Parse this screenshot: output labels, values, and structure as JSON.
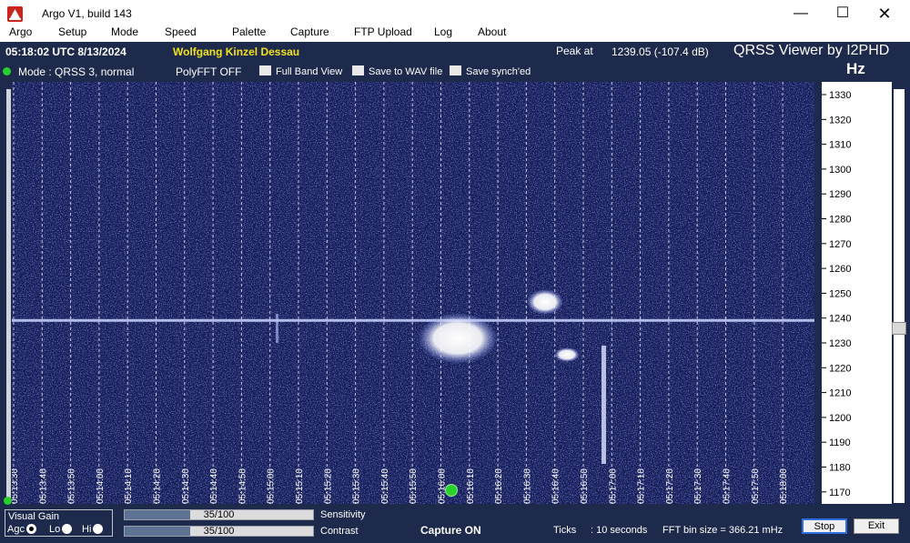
{
  "window": {
    "title": "Argo V1, build 143",
    "minimize": "—",
    "maximize": "☐",
    "close": "✕"
  },
  "menu": [
    "Argo",
    "Setup",
    "Mode",
    "Speed",
    "Palette",
    "Capture",
    "FTP Upload",
    "Log",
    "About"
  ],
  "status": {
    "time": "05:18:02 UTC  8/13/2024",
    "name": "Wolfgang Kinzel Dessau",
    "peak_label": "Peak at",
    "peak_value": "1239.05 (-107.4 dB)",
    "brand": "QRSS Viewer by I2PHD",
    "unit": "Hz"
  },
  "options": {
    "mode": "Mode : QRSS 3, normal",
    "polyfft": "PolyFFT OFF",
    "checkboxes": [
      "Full Band View",
      "Save to WAV file",
      "Save synch'ed"
    ]
  },
  "freq_axis": {
    "ticks": [
      "1330",
      "1320",
      "1310",
      "1300",
      "1290",
      "1280",
      "1270",
      "1260",
      "1250",
      "1240",
      "1230",
      "1220",
      "1210",
      "1200",
      "1190",
      "1180",
      "1170"
    ],
    "signal_hz": 1239.05
  },
  "time_axis": {
    "labels": [
      "05:13:30",
      "05:13:40",
      "05:13:50",
      "05:14:00",
      "05:14:10",
      "05:14:20",
      "05:14:30",
      "05:14:40",
      "05:14:50",
      "05:15:00",
      "05:15:10",
      "05:15:20",
      "05:15:30",
      "05:15:40",
      "05:15:50",
      "05:16:00",
      "05:16:10",
      "05:16:20",
      "05:16:30",
      "05:16:40",
      "05:16:50",
      "05:17:00",
      "05:17:10",
      "05:17:20",
      "05:17:30",
      "05:17:40",
      "05:17:50",
      "05:18:00"
    ]
  },
  "controls": {
    "visual_gain": {
      "title": "Visual Gain",
      "agc": "Agc",
      "lo": "Lo",
      "hi": "Hi",
      "selected": "Agc"
    },
    "sensitivity": {
      "label": "Sensitivity",
      "text": "35/100",
      "level": 0.35
    },
    "contrast": {
      "label": "Contrast",
      "text": "35/100",
      "level": 0.35
    },
    "capture": "Capture ON",
    "ticks_label": "Ticks",
    "ticks_value": ": 10 seconds",
    "fft_bin": "FFT bin size = 366.21 mHz",
    "stop": "Stop",
    "exit": "Exit"
  },
  "colors": {
    "background": "#1e2a4b",
    "waterfall": "#141c5a",
    "accent": "#f2e21d",
    "led": "#27d12c"
  }
}
